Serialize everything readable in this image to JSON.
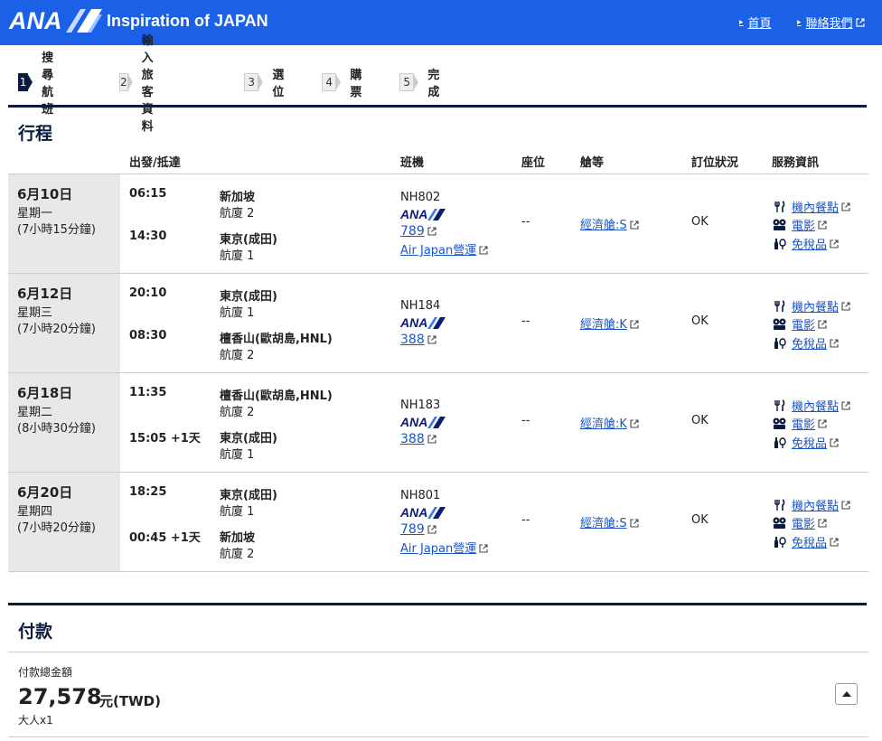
{
  "header": {
    "logo_text": "ANA",
    "tagline": "Inspiration of JAPAN",
    "home_link": "首頁",
    "contact_link": "聯絡我們"
  },
  "steps": [
    {
      "num": "1",
      "label": "搜尋航班",
      "active": true
    },
    {
      "num": "2",
      "label": "輸入旅客資料",
      "active": false
    },
    {
      "num": "3",
      "label": "選位",
      "active": false
    },
    {
      "num": "4",
      "label": "購票",
      "active": false
    },
    {
      "num": "5",
      "label": "完成",
      "active": false
    }
  ],
  "itinerary": {
    "title": "行程",
    "columns": {
      "depart_arrive": "出發/抵達",
      "flight": "班機",
      "seat": "座位",
      "cabin": "艙等",
      "booking_status": "訂位狀況",
      "services": "服務資訊"
    },
    "flights": [
      {
        "date": "6月10日",
        "weekday": "星期一",
        "duration": "(7小時15分鐘)",
        "dep_time": "06:15",
        "dep_place": "新加坡",
        "dep_terminal": "航廈 2",
        "arr_time": "14:30",
        "arr_place": "東京(成田)",
        "arr_terminal": "航廈 1",
        "flight_no": "NH802",
        "airline_logo": "ANA",
        "aircraft": "789",
        "operated_by": "Air Japan營運",
        "seat": "--",
        "cabin": "經濟艙:S",
        "status": "OK",
        "services": [
          "機內餐點",
          "電影",
          "免稅品"
        ]
      },
      {
        "date": "6月12日",
        "weekday": "星期三",
        "duration": "(7小時20分鐘)",
        "dep_time": "20:10",
        "dep_place": "東京(成田)",
        "dep_terminal": "航廈 1",
        "arr_time": "08:30",
        "arr_place": "檀香山(歐胡島,HNL)",
        "arr_terminal": "航廈 2",
        "flight_no": "NH184",
        "airline_logo": "ANA",
        "aircraft": "388",
        "operated_by": "",
        "seat": "--",
        "cabin": "經濟艙:K",
        "status": "OK",
        "services": [
          "機內餐點",
          "電影",
          "免稅品"
        ]
      },
      {
        "date": "6月18日",
        "weekday": "星期二",
        "duration": "(8小時30分鐘)",
        "dep_time": "11:35",
        "dep_place": "檀香山(歐胡島,HNL)",
        "dep_terminal": "航廈 2",
        "arr_time": "15:05 +1天",
        "arr_place": "東京(成田)",
        "arr_terminal": "航廈 1",
        "flight_no": "NH183",
        "airline_logo": "ANA",
        "aircraft": "388",
        "operated_by": "",
        "seat": "--",
        "cabin": "經濟艙:K",
        "status": "OK",
        "services": [
          "機內餐點",
          "電影",
          "免稅品"
        ]
      },
      {
        "date": "6月20日",
        "weekday": "星期四",
        "duration": "(7小時20分鐘)",
        "dep_time": "18:25",
        "dep_place": "東京(成田)",
        "dep_terminal": "航廈 1",
        "arr_time": "00:45 +1天",
        "arr_place": "新加坡",
        "arr_terminal": "航廈 2",
        "flight_no": "NH801",
        "airline_logo": "ANA",
        "aircraft": "789",
        "operated_by": "Air Japan營運",
        "seat": "--",
        "cabin": "經濟艙:S",
        "status": "OK",
        "services": [
          "機內餐點",
          "電影",
          "免稅品"
        ]
      }
    ]
  },
  "payment": {
    "title": "付款",
    "total_label": "付款總金額",
    "amount": "27,578",
    "currency": "元(TWD)",
    "passengers": "大人x1"
  },
  "colors": {
    "header_blue": "#1a61e8",
    "navy": "#0a1b3d",
    "link_blue": "#1a55c8",
    "date_bg": "#e8e8e8"
  }
}
